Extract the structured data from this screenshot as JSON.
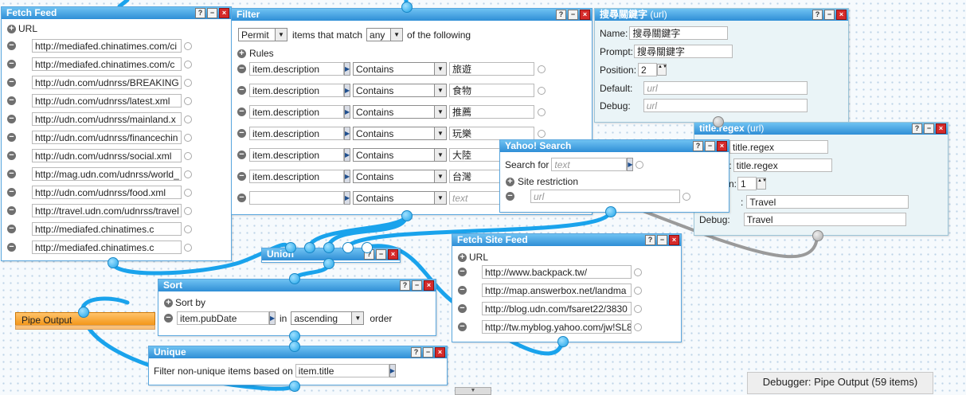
{
  "fetch_feed": {
    "title": "Fetch Feed",
    "url_label": "URL",
    "urls": [
      "http://mediafed.chinatimes.com/ci",
      " http://mediafed.chinatimes.com/c",
      "http://udn.com/udnrss/BREAKING",
      "http://udn.com/udnrss/latest.xml",
      "http://udn.com/udnrss/mainland.x",
      "http://udn.com/udnrss/financechin",
      "http://udn.com/udnrss/social.xml",
      "http://mag.udn.com/udnrss/world_",
      "http://udn.com/udnrss/food.xml",
      "http://travel.udn.com/udnrss/travel",
      "        http://mediafed.chinatimes.c",
      "        http://mediafed.chinatimes.c"
    ]
  },
  "filter": {
    "title": "Filter",
    "mode": "Permit",
    "items_that_match": "items that match",
    "quantifier": "any",
    "of_the_following": "of the following",
    "rules_label": "Rules",
    "rules": [
      {
        "field": "item.description",
        "op": "Contains",
        "value": "旅遊"
      },
      {
        "field": "item.description",
        "op": "Contains",
        "value": "食物"
      },
      {
        "field": "item.description",
        "op": "Contains",
        "value": "推薦"
      },
      {
        "field": "item.description",
        "op": "Contains",
        "value": "玩樂"
      },
      {
        "field": "item.description",
        "op": "Contains",
        "value": "大陸"
      },
      {
        "field": "item.description",
        "op": "Contains",
        "value": "台灣"
      },
      {
        "field": "",
        "op": "Contains",
        "value": "text"
      }
    ]
  },
  "user_input": {
    "title": "搜尋關鍵字",
    "title_suffix": "(url)",
    "name_label": "Name:",
    "name_value": "搜尋關鍵字",
    "prompt_label": "Prompt:",
    "prompt_value": "搜尋關鍵字",
    "position_label": "Position:",
    "position_value": "2",
    "default_label": "Default:",
    "default_placeholder": "url",
    "debug_label": "Debug:",
    "debug_placeholder": "url"
  },
  "regex_input": {
    "title": "title.regex",
    "title_suffix": "(url)",
    "name_partial": "",
    "name_value": "title.regex",
    "prompt_partial": "t:",
    "prompt_value": "title.regex",
    "position_partial": "n:",
    "position_value": "1",
    "default_partial": ":",
    "default_value": "Travel",
    "debug_label": "Debug:",
    "debug_value": "Travel"
  },
  "yahoo_search": {
    "title": "Yahoo! Search",
    "search_for_label": "Search for",
    "search_placeholder": "text",
    "site_restriction_label": "Site restriction",
    "url_placeholder": "url"
  },
  "union": {
    "title": "Union"
  },
  "sort": {
    "title": "Sort",
    "sort_by_label": "Sort by",
    "field": "item.pubDate",
    "in_label": "in",
    "direction": "ascending",
    "order_label": "order"
  },
  "fetch_site_feed": {
    "title": "Fetch Site Feed",
    "url_label": "URL",
    "urls": [
      "http://www.backpack.tw/",
      "http://map.answerbox.net/landma",
      "http://blog.udn.com/fsaret22/3830",
      "http://tw.myblog.yahoo.com/jw!SL8"
    ]
  },
  "unique": {
    "title": "Unique",
    "label": "Filter non-unique items based on",
    "field": "item.title"
  },
  "pipe_output": {
    "title": "Pipe Output"
  },
  "debugger": {
    "label": "Debugger: Pipe Output (59 items)"
  },
  "window_buttons": {
    "help": "?",
    "minimize": "−",
    "close": "×"
  },
  "glyphs": {
    "plus": "+",
    "minus": "−",
    "dropdown": "▼",
    "arrow": "▶",
    "spin": "▲▼"
  },
  "colors": {
    "module_header": "#2f8ed6",
    "wire": "#29a9ec",
    "pipe_output": "#f29314",
    "close_button": "#d52a2a"
  }
}
